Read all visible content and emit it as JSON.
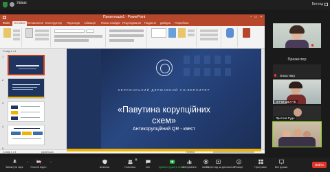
{
  "topbar": {
    "title": "Увімк",
    "view_label": "Вигляд"
  },
  "ppt": {
    "window_title": "Презентація1 - PowerPoint",
    "tabs": [
      "Файл",
      "Основна",
      "Вставлення",
      "Конструктор",
      "Переходи",
      "Анімація",
      "Показ слайдів",
      "Рецензування",
      "Подання",
      "Довідка",
      "Розробник"
    ],
    "active_tab_index": 1,
    "thumbnail_header": "Слайд 1 з 4",
    "slide_numbers": [
      "1",
      "2",
      "3",
      "4",
      "5"
    ],
    "status_left": "Слайд 1 з 4",
    "status_lang": "українська",
    "status_right": "Нотатки"
  },
  "slide": {
    "university": "ХЕРСОНСЬКИЙ ДЕРЖАВНИЙ УНІВЕРСИТЕТ",
    "title_line1": "«Павутина корупційних",
    "title_line2": "схем»",
    "subtitle": "Антикорупційний QR - квест"
  },
  "gallery": {
    "presenter_label": "Презентер",
    "tiles": [
      {
        "name": ""
      },
      {
        "name": "Ольга Нагр"
      },
      {
        "name": "ОПЧМ ШЕЛ ЧЕ"
      },
      {
        "name": "Ярослав Рудн"
      }
    ]
  },
  "toolbar": {
    "items": [
      {
        "label": "Вимкнути звук"
      },
      {
        "label": "Почати відео"
      },
      {
        "label": "Безпека"
      },
      {
        "label": "Учасники",
        "badge": "5"
      },
      {
        "label": "Чат"
      },
      {
        "label": "Демонструвати екран"
      },
      {
        "label": "Опитування"
      },
      {
        "label": "Запис"
      },
      {
        "label": "Перегляд за допомогою"
      },
      {
        "label": "Реакції"
      },
      {
        "label": "Програми"
      },
      {
        "label": "Білі дошки"
      }
    ],
    "leave_label": "Вийти"
  },
  "colors": {
    "ppt_accent": "#b7472a",
    "slide_bg": "#1f3560",
    "slide_stripe": "#f0b400",
    "share_green": "#2dbe4e",
    "leave_red": "#e0342a"
  }
}
